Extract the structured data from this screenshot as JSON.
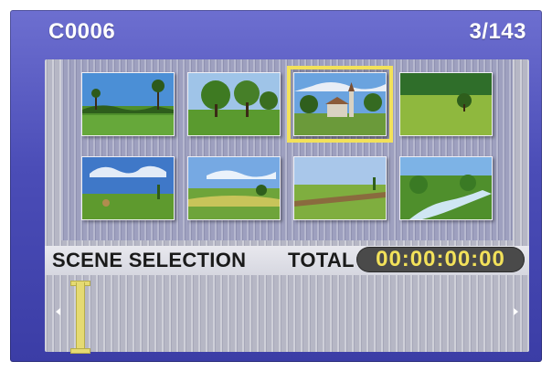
{
  "header": {
    "clip_name": "C0006",
    "clip_counter": "3/143"
  },
  "thumbnails": [
    {
      "scene": "palm-beach",
      "selected": false
    },
    {
      "scene": "park-trees",
      "selected": false
    },
    {
      "scene": "village-church",
      "selected": true
    },
    {
      "scene": "lone-tree-meadow",
      "selected": false
    },
    {
      "scene": "cloudy-field-hay",
      "selected": false
    },
    {
      "scene": "farm-hills",
      "selected": false
    },
    {
      "scene": "plowed-field",
      "selected": false
    },
    {
      "scene": "mountain-stream",
      "selected": false
    }
  ],
  "status_bar": {
    "label": "SCENE SELECTION",
    "total_label": "TOTAL",
    "timecode": "00:00:00:00"
  },
  "timeline": {
    "cursor_icon": "timeline-cursor-icon",
    "left_arrow_icon": "triangle-left-icon",
    "right_arrow_icon": "triangle-right-icon"
  },
  "colors": {
    "background": "#4b4db7",
    "highlight": "#f2e15a",
    "timecode_bg": "#4a4a4a"
  }
}
